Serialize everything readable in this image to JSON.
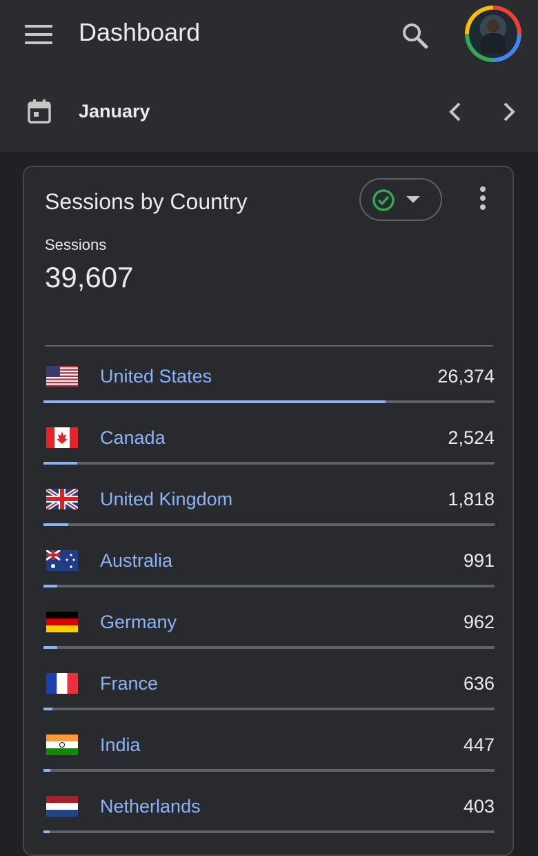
{
  "app": {
    "title": "Dashboard",
    "month": "January"
  },
  "card": {
    "title": "Sessions by Country",
    "metric_label": "Sessions",
    "metric_value": "39,607"
  },
  "colors": {
    "accent": "#8ab4f8",
    "check": "#34a853"
  },
  "icons": [
    "menu-icon",
    "search-icon",
    "calendar-icon",
    "chevron-left-icon",
    "chevron-right-icon",
    "check-circle-icon",
    "dropdown-caret-icon",
    "more-vert-icon"
  ],
  "countries": [
    {
      "name": "United States",
      "value": "26,374",
      "fraction": 0.758,
      "flag": "us-flag"
    },
    {
      "name": "Canada",
      "value": "2,524",
      "fraction": 0.075,
      "flag": "canada-flag"
    },
    {
      "name": "United Kingdom",
      "value": "1,818",
      "fraction": 0.055,
      "flag": "uk-flag"
    },
    {
      "name": "Australia",
      "value": "991",
      "fraction": 0.03,
      "flag": "australia-flag"
    },
    {
      "name": "Germany",
      "value": "962",
      "fraction": 0.03,
      "flag": "germany-flag"
    },
    {
      "name": "France",
      "value": "636",
      "fraction": 0.02,
      "flag": "france-flag"
    },
    {
      "name": "India",
      "value": "447",
      "fraction": 0.016,
      "flag": "india-flag"
    },
    {
      "name": "Netherlands",
      "value": "403",
      "fraction": 0.014,
      "flag": "netherlands-flag"
    }
  ]
}
